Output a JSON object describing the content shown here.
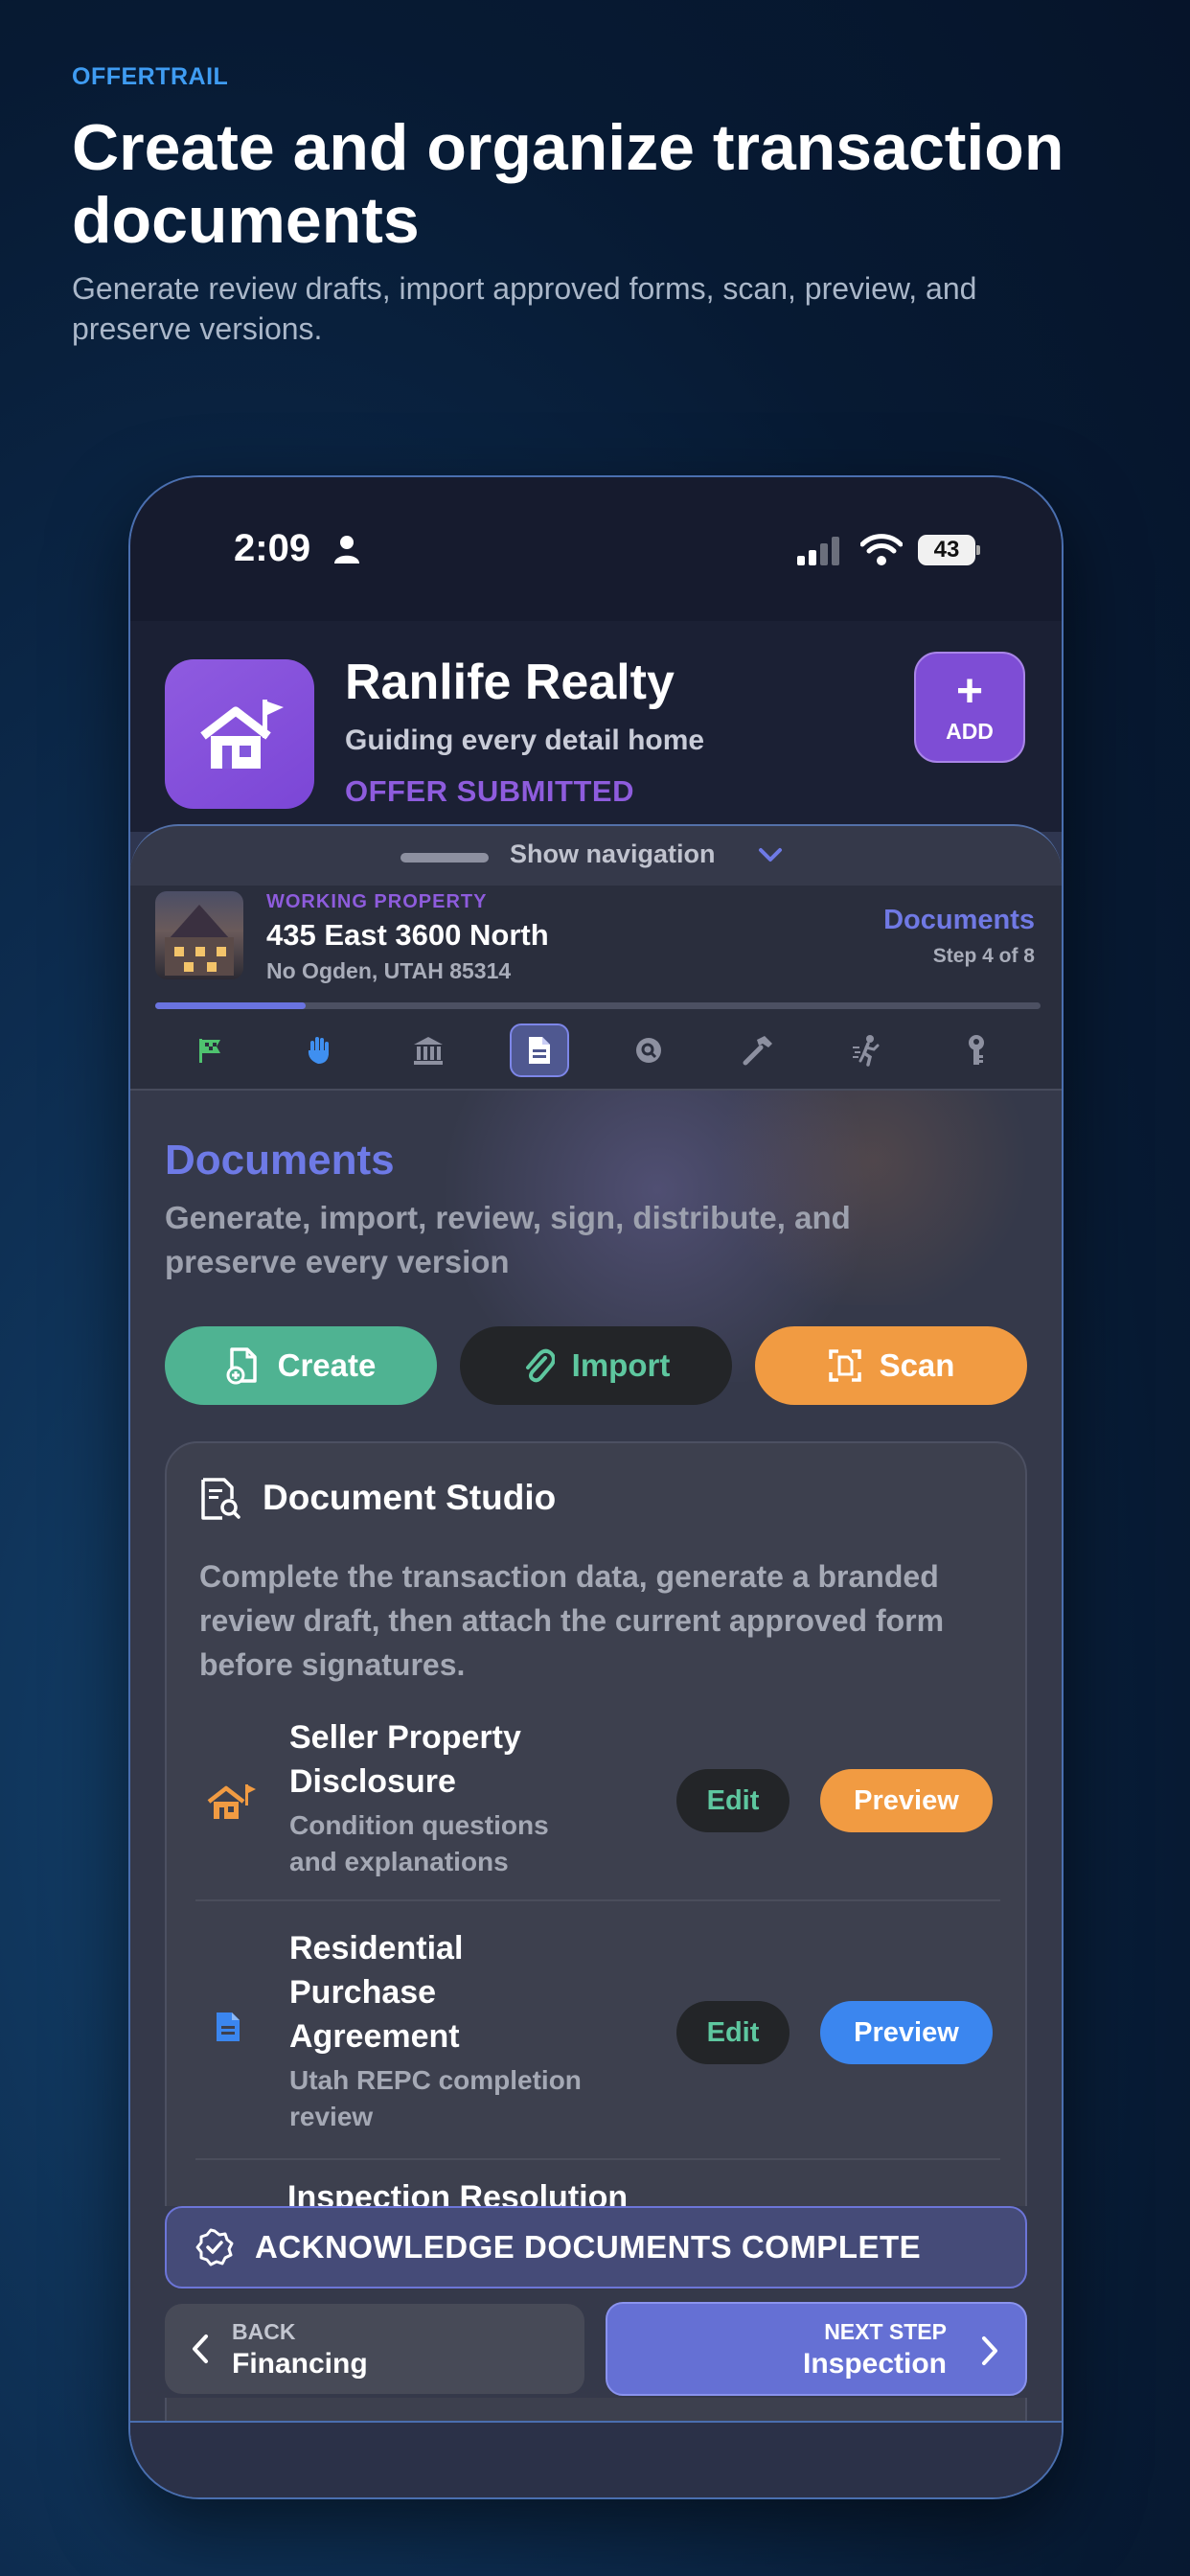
{
  "brand": "OFFERTRAIL",
  "headline": "Create and organize transaction documents",
  "subline": "Generate review drafts, import approved forms, scan, preview, and preserve versions.",
  "status_bar": {
    "time": "2:09",
    "battery": "43"
  },
  "app": {
    "name": "Ranlife Realty",
    "tagline": "Guiding every detail home",
    "status": "OFFER SUBMITTED",
    "add_label": "ADD"
  },
  "nav_toggle": "Show navigation",
  "property": {
    "label": "WORKING PROPERTY",
    "address": "435 East 3600 North",
    "city": "No Ogden, UTAH 85314",
    "section": "Documents",
    "step": "Step 4 of 8",
    "progress": 0.17
  },
  "step_tabs": [
    {
      "name": "flag-icon",
      "color": "#4fc36f"
    },
    {
      "name": "hand-icon",
      "color": "#3f8ff0"
    },
    {
      "name": "bank-icon",
      "color": "#8d90a0"
    },
    {
      "name": "document-icon",
      "color": "#ffffff",
      "active": true
    },
    {
      "name": "search-icon",
      "color": "#8d90a0"
    },
    {
      "name": "hammer-icon",
      "color": "#8d90a0"
    },
    {
      "name": "walk-icon",
      "color": "#8d90a0"
    },
    {
      "name": "key-icon",
      "color": "#8d90a0"
    }
  ],
  "section": {
    "title": "Documents",
    "description": "Generate, import, review, sign, distribute, and preserve every version"
  },
  "actions": {
    "create": "Create",
    "import": "Import",
    "scan": "Scan"
  },
  "studio": {
    "title": "Document Studio",
    "description": "Complete the transaction data, generate a branded review draft, then attach the current approved form before signatures.",
    "documents": [
      {
        "title": "Seller Property Disclosure",
        "subtitle": "Condition questions and explanations",
        "edit": "Edit",
        "preview": "Preview",
        "preview_color": "#f19b42",
        "icon": "house-flag-icon"
      },
      {
        "title": "Residential Purchase Agreement",
        "subtitle": "Utah REPC completion review",
        "edit": "Edit",
        "preview": "Preview",
        "preview_color": "#3b86ef",
        "icon": "document-icon"
      }
    ],
    "partial_title": "Inspection Resolution"
  },
  "footer": {
    "acknowledge": "ACKNOWLEDGE DOCUMENTS COMPLETE",
    "back_kicker": "BACK",
    "back_label": "Financing",
    "next_kicker": "NEXT STEP",
    "next_label": "Inspection"
  }
}
